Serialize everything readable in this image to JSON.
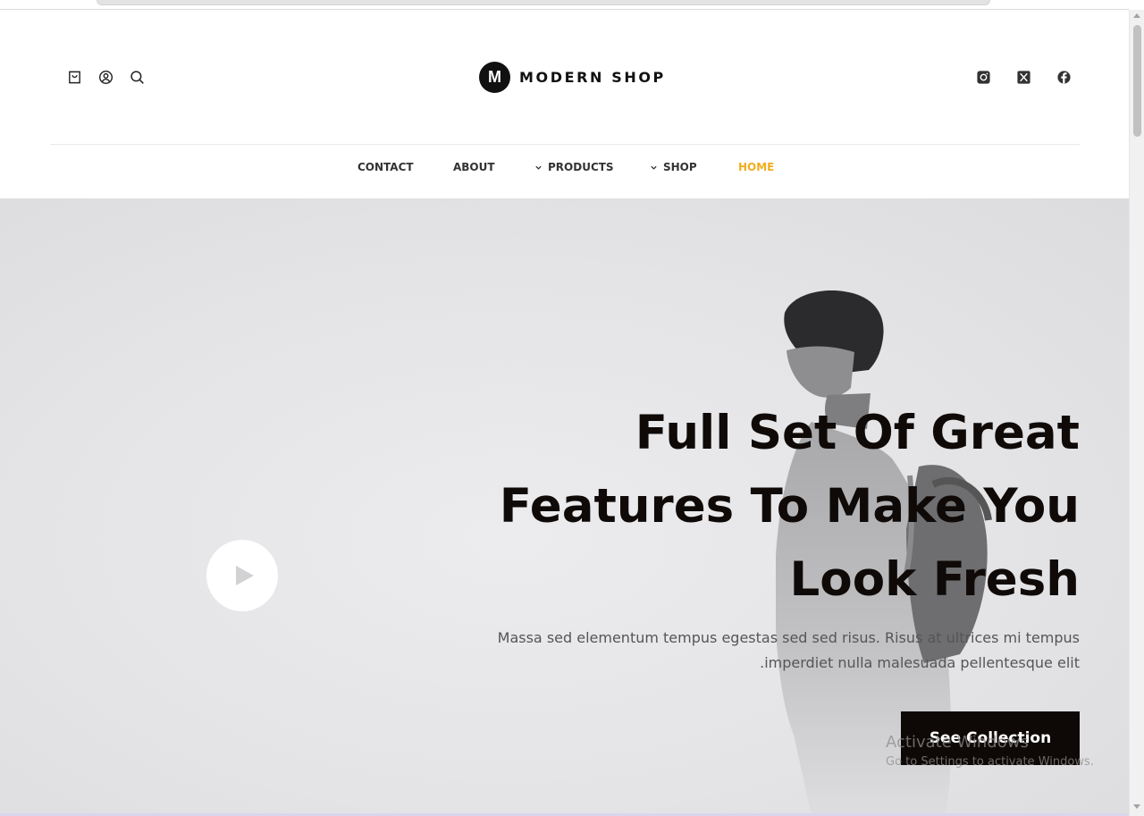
{
  "brand": {
    "logo_letter": "M",
    "name": "MODERN SHOP"
  },
  "header_icons": {
    "left": [
      "shopping-bag-icon",
      "user-account-icon",
      "search-icon"
    ],
    "right": [
      "instagram-icon",
      "x-twitter-icon",
      "facebook-icon"
    ]
  },
  "nav": {
    "items": [
      {
        "label": "CONTACT",
        "has_dropdown": false,
        "active": false
      },
      {
        "label": "ABOUT",
        "has_dropdown": false,
        "active": false
      },
      {
        "label": "PRODUCTS",
        "has_dropdown": true,
        "active": false
      },
      {
        "label": "SHOP",
        "has_dropdown": true,
        "active": false
      },
      {
        "label": "HOME",
        "has_dropdown": false,
        "active": true
      }
    ]
  },
  "hero": {
    "title_lines": [
      "Full Set Of Great",
      "Features To Make You",
      "Look Fresh"
    ],
    "subtitle_lines": [
      "Massa sed elementum tempus egestas sed sed risus. Risus at ultrices mi tempus",
      ".imperdiet nulla malesuada pellentesque elit"
    ],
    "cta_label": "See Collection",
    "play_icon": "play-icon"
  },
  "watermark": {
    "title": "Activate Windows",
    "subtitle": "Go to Settings to activate Windows."
  },
  "colors": {
    "accent": "#f0ad1f",
    "text_dark": "#0f0a08",
    "cta_bg": "#0e0806",
    "hero_bg": "#e4e4e6"
  }
}
